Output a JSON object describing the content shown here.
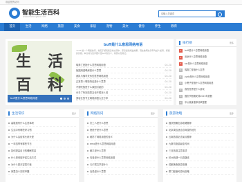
{
  "topbar": {
    "text": "欢迎您的访问"
  },
  "site": {
    "title": "智能生活百科",
    "subtitle": "www.zhshenghuo.com"
  },
  "search": {
    "placeholder": "请输入关键词"
  },
  "nav": [
    "首页",
    "生活",
    "网络",
    "旅游",
    "美食",
    "家居",
    "宠物",
    "美文",
    "健身",
    "养生",
    "教育"
  ],
  "banner": {
    "chars": [
      "生",
      "活",
      "百",
      "科"
    ],
    "caption": "buff是什么意思网络用语"
  },
  "featured": {
    "title": "buff是什么意思网络用语",
    "summary": "\"buff\"是一个网络热词，常见于游戏和日常交流中，原意是指增益效果，现在被网友引申为给人加持、祝福的意思。本文将为您详细介绍buff的含义、来源以及用法。"
  },
  "latest": [
    {
      "title": "嘴角亡是指什么意思网络用语",
      "date": "04-20"
    },
    {
      "title": "饭圈用语塌房是什么意思",
      "date": "04-20"
    },
    {
      "title": "我执与佛学关系的意思网络用语",
      "date": "04-20"
    },
    {
      "title": "正常男人哪些特征是什么意思",
      "date": "04-20"
    },
    {
      "title": "不想吃饭是什么原因引起的",
      "date": "04-20"
    },
    {
      "title": "分手了听到前男友也不想怎么说",
      "date": "04-20"
    },
    {
      "title": "美容业的专业网络用语大全分享",
      "date": "04-20"
    }
  ],
  "ranking": {
    "title": "排行榜",
    "more": "更多",
    "items": [
      "buff是什么意思网络用语",
      "出轨什么意思网络用语",
      "ssr是什么意思网络用语",
      "嘴角亡是指什么意思",
      "yyds是什么意思网络用语",
      "小黑子是指什么意思网络用语",
      "我的世界是什么游戏",
      "国庆节假期安排2023年放假",
      "平价美食推荐清单整理",
      "春节假期怎么安排比较合理"
    ]
  },
  "sections": [
    {
      "title": "生活常识",
      "more": "更多",
      "items": [
        "高楼层有什么注意事项",
        "生活中有哪些好习惯",
        "为什么会经常头疼头晕",
        "一年四季有哪些节日",
        "如何提高自己的睡眠质量",
        "什么是低碳环保生活方式",
        "为什么夏天容易中暑",
        "家里怎么清除甲醛"
      ]
    },
    {
      "title": "网络热词",
      "more": "更多",
      "items": [
        "打工人是什么意思",
        "绝绝子是什么意思",
        "破防了网络用语的含义",
        "emo是什么意思网络用语",
        "躺平是什么意思",
        "内卷是什么意思网络用语",
        "凡尔赛文学是什么",
        "社恐是什么意思"
      ]
    },
    {
      "title": "旅游攻略",
      "more": "更多",
      "items": [
        "国庆假期出游攻略推荐",
        "北京周边适合自驾游的地方",
        "云南旅游必去景点推荐",
        "九寨沟旅游最佳时间",
        "三亚旅游注意事项",
        "杭州西湖一日游路线",
        "成都美食旅游攻略",
        "厦门鼓浪屿游玩攻略"
      ]
    }
  ]
}
